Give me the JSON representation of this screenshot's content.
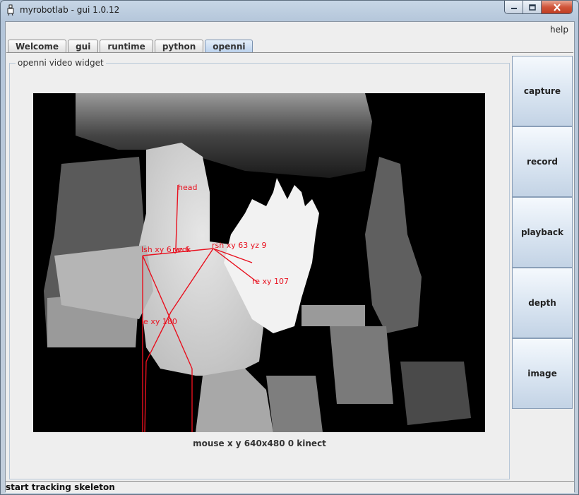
{
  "window": {
    "title": "myrobotlab - gui 1.0.12"
  },
  "menu": {
    "help_label": "help"
  },
  "tabs": [
    {
      "label": "Welcome",
      "active": false
    },
    {
      "label": "gui",
      "active": false
    },
    {
      "label": "runtime",
      "active": false
    },
    {
      "label": "python",
      "active": false
    },
    {
      "label": "openni",
      "active": true
    }
  ],
  "widget": {
    "title": "openni  video widget",
    "caption": "mouse x y  640x480  0  kinect"
  },
  "skeleton": {
    "color": "#e8101e",
    "labels": {
      "head": "head",
      "lsh": "lsh xy 6 yz 6",
      "neck": "neck",
      "rsh": "rsh xy 63 yz 9",
      "re": "re xy 107",
      "le": "le xy 180"
    }
  },
  "side_buttons": [
    {
      "label": "capture"
    },
    {
      "label": "record"
    },
    {
      "label": "playback"
    },
    {
      "label": "depth"
    },
    {
      "label": "image"
    }
  ],
  "status": {
    "text": "start tracking skeleton"
  }
}
